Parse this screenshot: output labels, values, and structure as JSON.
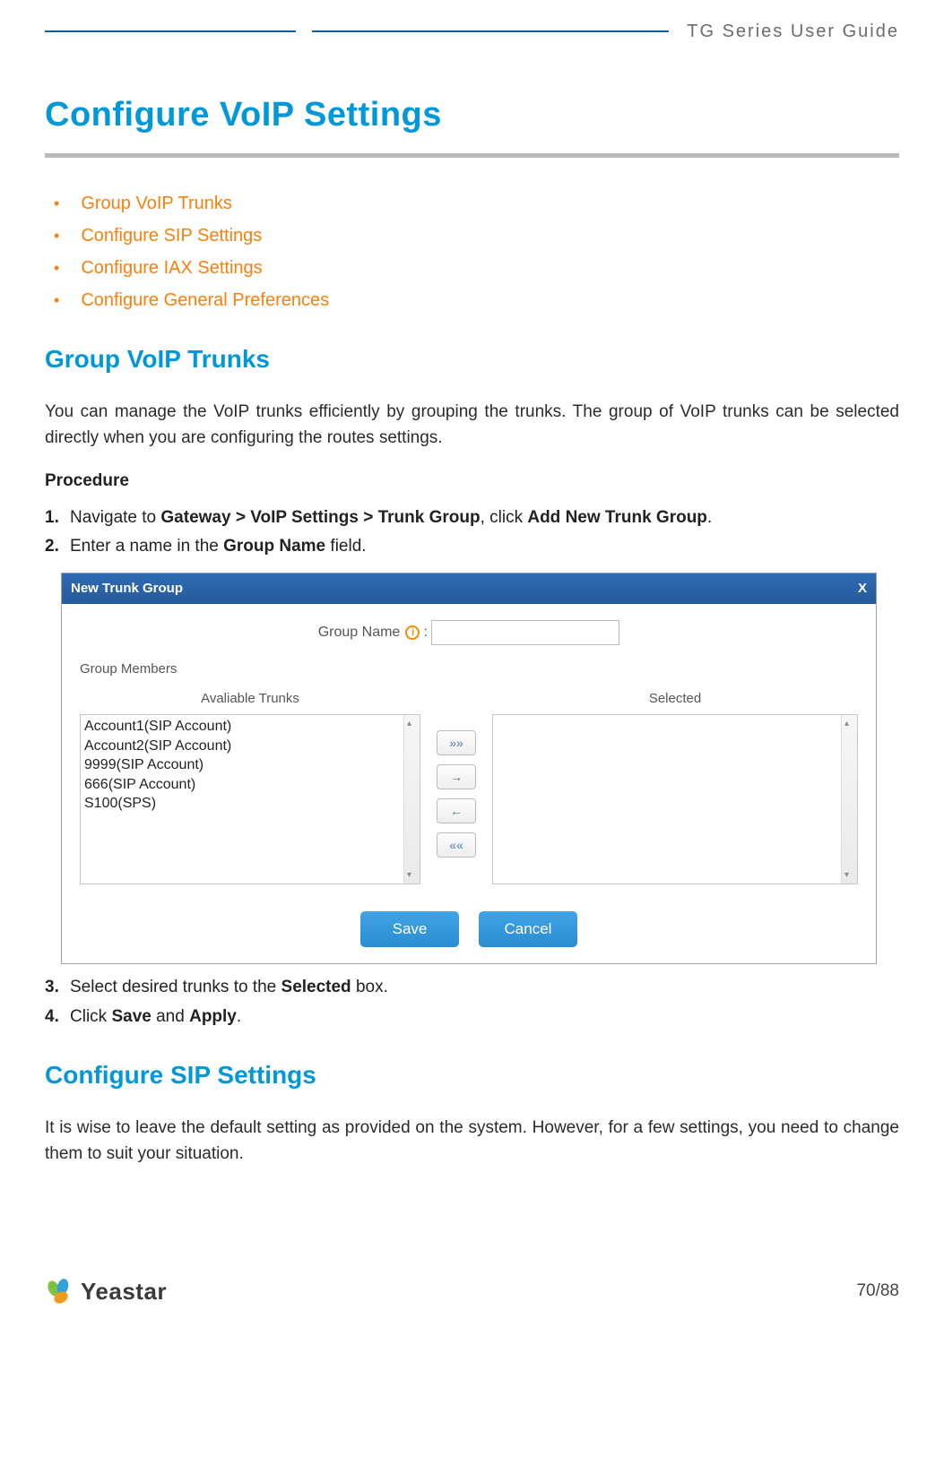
{
  "doc_header": "TG  Series  User  Guide",
  "page_title": "Configure VoIP Settings",
  "toc": [
    "Group VoIP Trunks",
    "Configure SIP Settings",
    "Configure IAX Settings",
    "Configure General Preferences"
  ],
  "section1": {
    "heading": "Group VoIP Trunks",
    "intro": "You can manage the VoIP trunks efficiently by grouping the trunks. The group of VoIP trunks can be selected directly when you are configuring the routes settings.",
    "procedure_label": "Procedure",
    "step1_pre": "Navigate to ",
    "step1_bold1": "Gateway > VoIP Settings > Trunk Group",
    "step1_mid": ", click ",
    "step1_bold2": "Add New Trunk Group",
    "step1_post": ".",
    "step2_pre": "Enter a name in the ",
    "step2_bold": "Group Name",
    "step2_post": " field.",
    "step3_pre": "Select desired trunks to the ",
    "step3_bold": "Selected",
    "step3_post": " box.",
    "step4_pre": "Click ",
    "step4_bold1": "Save",
    "step4_mid": " and ",
    "step4_bold2": "Apply",
    "step4_post": "."
  },
  "dialog": {
    "title": "New Trunk Group",
    "close": "X",
    "group_name_label": "Group Name",
    "group_name_colon": " :",
    "info_icon": "i",
    "group_members": "Group Members",
    "available_header": "Avaliable Trunks",
    "selected_header": "Selected",
    "available_items": [
      "Account1(SIP Account)",
      "Account2(SIP Account)",
      "9999(SIP Account)",
      "666(SIP Account)",
      "S100(SPS)"
    ],
    "btn_all_right": "»»",
    "btn_right": "→",
    "btn_left": "←",
    "btn_all_left": "««",
    "save": "Save",
    "cancel": "Cancel"
  },
  "section2": {
    "heading": "Configure SIP Settings",
    "intro": "It is wise to leave the default setting as provided on the system. However, for a few settings, you need to change them to suit your situation."
  },
  "footer": {
    "brand": "Yeastar",
    "page": "70/88"
  }
}
